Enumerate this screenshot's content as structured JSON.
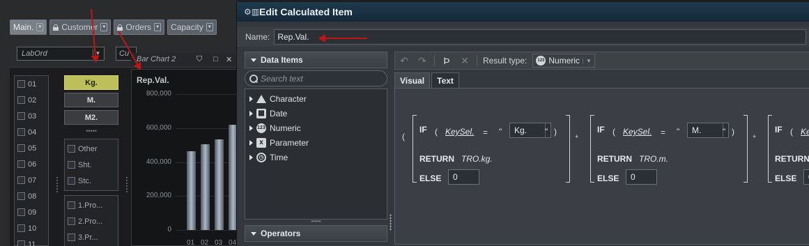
{
  "background": {
    "tabs": [
      {
        "label": "Main.",
        "locked": false
      },
      {
        "label": "Customer",
        "locked": true
      },
      {
        "label": "Orders",
        "locked": true
      },
      {
        "label": "Capacity",
        "locked": false
      }
    ],
    "filter_value": "LabOrd",
    "filter_partial": "Cu",
    "chart_window_title": "Bar Chart 2",
    "chart_heading": "Rep.Val.",
    "check_rows": [
      "01",
      "02",
      "03",
      "04",
      "05",
      "06",
      "07",
      "08",
      "09",
      "10",
      "11"
    ],
    "unit_buttons": [
      {
        "label": "Kg.",
        "selected": true
      },
      {
        "label": "M.",
        "selected": false
      },
      {
        "label": "M2.",
        "selected": false
      }
    ],
    "unit_dots": "•••••",
    "category_items_1": [
      "Other",
      "Sht.",
      "Stc."
    ],
    "category_items_2": [
      "1.Pro...",
      "2.Pro...",
      "3.Pr..."
    ],
    "colors": {
      "selected_unit": "#bdbf5a",
      "annotation_arrow": "#c01515"
    }
  },
  "chart_data": {
    "type": "bar",
    "title": "Rep.Val.",
    "categories": [
      "01",
      "02",
      "03",
      "04"
    ],
    "values": [
      465000,
      505000,
      535000,
      620000
    ],
    "yticks": [
      "800,000",
      "600,000",
      "400,000",
      "200,000",
      "0"
    ],
    "ylim": [
      0,
      800000
    ],
    "xlabel": "",
    "ylabel": ""
  },
  "dialog": {
    "title": "Edit Calculated Item",
    "name_label": "Name:",
    "name_value": "Rep.Val.",
    "data_items_header": "Data Items",
    "search_placeholder": "Search text",
    "tree_items": [
      {
        "label": "Character",
        "icon": "character-type-icon"
      },
      {
        "label": "Date",
        "icon": "calendar-icon"
      },
      {
        "label": "Numeric",
        "icon": "numeric-type-icon"
      },
      {
        "label": "Parameter",
        "icon": "parameter-icon"
      },
      {
        "label": "Time",
        "icon": "clock-icon"
      }
    ],
    "splitter_dots": "•••••",
    "operators_header": "Operators",
    "toolbar": {
      "result_type_label": "Result type:",
      "result_type_value": "Numeric"
    },
    "tabs": [
      {
        "label": "Visual",
        "active": false
      },
      {
        "label": "Text",
        "active": true
      }
    ],
    "expression": {
      "open_paren": "(",
      "plus": "+",
      "blocks": [
        {
          "if": "IF",
          "field": "KeySel.",
          "op": "=",
          "quote_open": "\"",
          "value": "Kg.",
          "quote_close": "\"",
          "return_kw": "RETURN",
          "return_value": "TRO.kg.",
          "else_kw": "ELSE",
          "else_value": "0"
        },
        {
          "if": "IF",
          "field": "KeySel.",
          "op": "=",
          "quote_open": "\"",
          "value": "M.",
          "quote_close": "\"",
          "return_kw": "RETURN",
          "return_value": "TRO.m.",
          "else_kw": "ELSE",
          "else_value": "0"
        },
        {
          "if": "IF",
          "field": "Ke",
          "op": "",
          "quote_open": "",
          "value": "",
          "quote_close": "",
          "return_kw": "RETURN",
          "return_value": "",
          "else_kw": "ELSE",
          "else_value": "0"
        }
      ]
    }
  }
}
